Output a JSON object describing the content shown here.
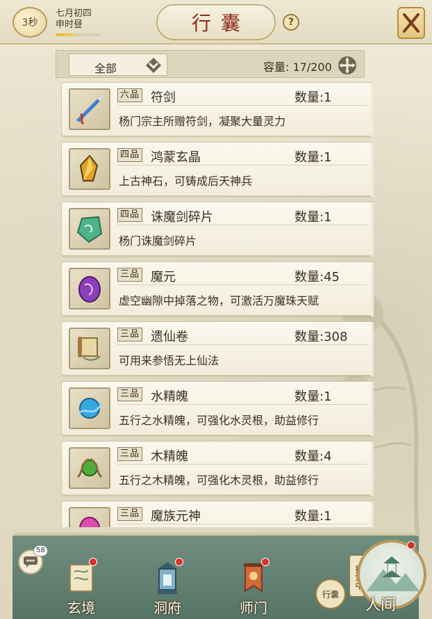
{
  "header": {
    "timer": "3秒",
    "lunar_date": "七月初四",
    "time_period": "申时昼",
    "time_progress": 0.45,
    "title": "行囊",
    "help_label": "?"
  },
  "filter": {
    "selected": "全部",
    "capacity_label": "容量:",
    "capacity_value": "17/200"
  },
  "qty_label": "数量:",
  "items": [
    {
      "grade": "六品",
      "name": "符剑",
      "qty": "1",
      "desc": "杨门宗主所赠符剑，凝聚大量灵力",
      "icon": "talisman-sword-icon"
    },
    {
      "grade": "四品",
      "name": "鸿蒙玄晶",
      "qty": "1",
      "desc": "上古神石，可铸成后天神兵",
      "icon": "crystal-icon"
    },
    {
      "grade": "四品",
      "name": "诛魔剑碎片",
      "qty": "1",
      "desc": "杨门诛魔剑碎片",
      "icon": "jade-shard-icon"
    },
    {
      "grade": "三品",
      "name": "魔元",
      "qty": "45",
      "desc": "虚空幽隙中掉落之物，可激活万魔珠天赋",
      "icon": "demon-orb-icon"
    },
    {
      "grade": "三品",
      "name": "遗仙卷",
      "qty": "308",
      "desc": "可用来参悟无上仙法",
      "icon": "scroll-icon"
    },
    {
      "grade": "三品",
      "name": "水精魄",
      "qty": "1",
      "desc": "五行之水精魄，可强化水灵根，助益修行",
      "icon": "water-essence-icon"
    },
    {
      "grade": "三品",
      "name": "木精魄",
      "qty": "4",
      "desc": "五行之木精魄，可强化木灵根，助益修行",
      "icon": "wood-essence-icon"
    },
    {
      "grade": "三品",
      "name": "魔族元神",
      "qty": "1",
      "desc": "",
      "icon": "demon-soul-icon"
    }
  ],
  "bottom_nav": {
    "chat_badge": "58",
    "tabs": [
      {
        "label": "玄境",
        "icon": "scroll-map-icon"
      },
      {
        "label": "洞府",
        "icon": "lantern-icon"
      },
      {
        "label": "师门",
        "icon": "banner-icon"
      }
    ],
    "bag_label": "行囊",
    "explore_label": "探索中",
    "world_label": "人间"
  },
  "colors": {
    "title_red": "#8a2a1a",
    "panel_green": "#6f8e7f",
    "notice_red": "#d9322a"
  }
}
